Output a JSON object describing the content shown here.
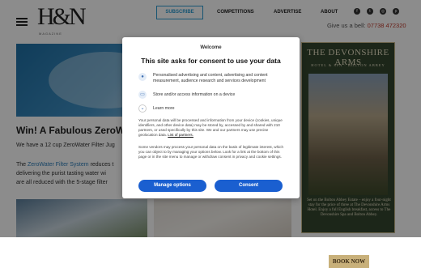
{
  "header": {
    "logo_text": "H&N",
    "logo_sub": "MAGAZINE",
    "subscribe_label": "SUBSCRIBE",
    "nav": [
      "COMPETITIONS",
      "ADVERTISE",
      "ABOUT"
    ],
    "social_icons": [
      "facebook-icon",
      "twitter-icon",
      "instagram-icon",
      "pinterest-icon"
    ],
    "phone_prefix": "Give us a bell: ",
    "phone_number": "07738 472320"
  },
  "article": {
    "title": "Win! A Fabulous ZeroW",
    "para1": "We have a 12 cup ZeroWater Filter Jug",
    "para2_link": "ZeroWater Filter System",
    "para2_pre": "The ",
    "para2_post": " reduces t",
    "para3": "delivering the purist tasting water wi",
    "para4": "are all reduced with the 5-stage filter"
  },
  "ad": {
    "title": "THE DEVONSHIRE ARMS",
    "subtitle": "HOTEL & SPA · BOLTON ABBEY",
    "text": "Set on the Bolton Abbey Estate – enjoy a four-night stay for the price of three at The Devonshire Arms Hotel. Enjoy a full English breakfast, access to The Devonshire Spa and Bolton Abbey.",
    "button": "BOOK NOW",
    "colors": {
      "background": "#33452f",
      "button": "#c8b07a"
    }
  },
  "consent": {
    "welcome": "Welcome",
    "heading": "This site asks for consent to use your data",
    "items": [
      "Personalised advertising and content, advertising and content measurement, audience research and services development",
      "Store and/or access information on a device",
      "Learn more"
    ],
    "body1": "Your personal data will be processed and information from your device (cookies, unique identifiers, and other device data) may be stored by, accessed by and shared with 210 partners, or used specifically by this site. We and our partners may use precise geolocation data. ",
    "body1_link": "List of partners.",
    "body2": "Some vendors may process your personal data on the basis of legitimate interest, which you can object to by managing your options below. Look for a link at the bottom of this page or in the site menu to manage or withdraw consent in privacy and cookie settings.",
    "manage_label": "Manage options",
    "consent_label": "Consent",
    "colors": {
      "button": "#1a5fd0"
    }
  }
}
